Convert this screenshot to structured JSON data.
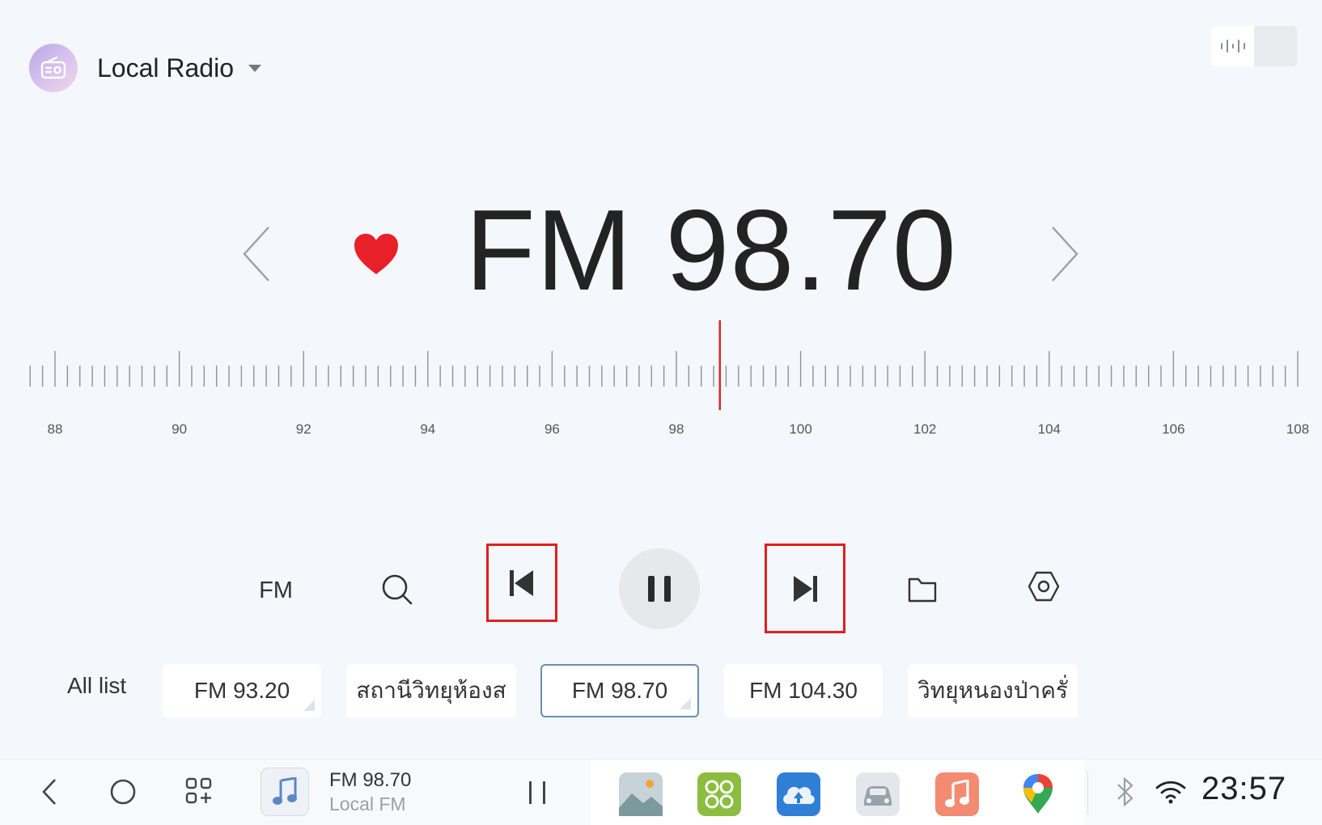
{
  "header": {
    "source_title": "Local Radio",
    "logo_icon": "radio-icon",
    "caret_icon": "caret-down-icon",
    "toggle_icon": "waveform-icon"
  },
  "tuner": {
    "band": "FM",
    "frequency_text": "FM 98.70",
    "current_frequency": 98.7,
    "favorite": true,
    "favorite_color": "#e8202a",
    "indicator_color": "#d32f2f",
    "range": [
      88,
      108
    ],
    "tick_step": 0.2,
    "labels": [
      "88",
      "90",
      "92",
      "94",
      "96",
      "98",
      "100",
      "102",
      "104",
      "106",
      "108"
    ]
  },
  "controls": {
    "band_label": "FM",
    "icons": [
      "search-icon",
      "skip-previous-icon",
      "pause-icon",
      "skip-next-icon",
      "folder-icon",
      "settings-icon"
    ]
  },
  "stations": {
    "all_list_label": "All list",
    "items": [
      {
        "label": "FM 93.20",
        "active": false,
        "corner": true
      },
      {
        "label": "สถานีวิทยุห้องส",
        "active": false,
        "corner": false
      },
      {
        "label": "FM 98.70",
        "active": true,
        "corner": true
      },
      {
        "label": "FM 104.30",
        "active": false,
        "corner": false
      },
      {
        "label": "วิทยุหนองป่าครั่",
        "active": false,
        "corner": false
      }
    ]
  },
  "dock": {
    "now_playing_title": "FM 98.70",
    "now_playing_subtitle": "Local FM",
    "clock": "23:57",
    "apps": [
      "gallery-app-icon",
      "apps-grid-app-icon",
      "ota-update-app-icon",
      "car-app-icon",
      "music-app-icon",
      "maps-app-icon"
    ]
  }
}
